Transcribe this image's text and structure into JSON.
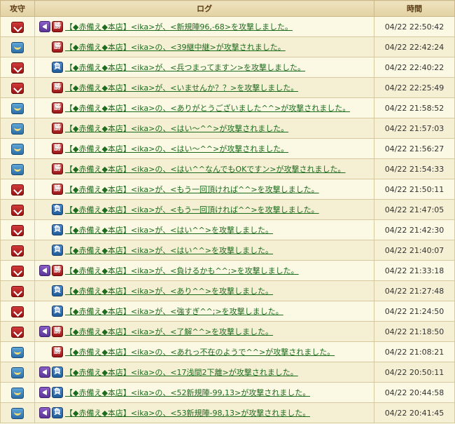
{
  "header": {
    "side": "攻守",
    "log": "ログ",
    "time": "時間"
  },
  "rows": [
    {
      "side": "attack",
      "icon": "purple",
      "result": "勝",
      "resultType": "win",
      "text": "【◆赤備え◆本店】<ika>が、<新規陣96,-68>を攻撃しました。",
      "time": "04/22 22:50:42"
    },
    {
      "side": "defense",
      "icon": "",
      "result": "勝",
      "resultType": "win",
      "text": "【◆赤備え◆本店】<ika>の、<39継中継>が攻撃されました。",
      "time": "04/22 22:42:24"
    },
    {
      "side": "attack",
      "icon": "",
      "result": "負",
      "resultType": "lose",
      "text": "【◆赤備え◆本店】<ika>が、<兵つまってますン>を攻撃しました。",
      "time": "04/22 22:40:22"
    },
    {
      "side": "attack",
      "icon": "",
      "result": "勝",
      "resultType": "win",
      "text": "【◆赤備え◆本店】<ika>が、<いませんか？？>を攻撃しました。",
      "time": "04/22 22:25:49"
    },
    {
      "side": "defense",
      "icon": "",
      "result": "勝",
      "resultType": "win",
      "text": "【◆赤備え◆本店】<ika>の、<ありがとうございました^^>が攻撃されました。",
      "time": "04/22 21:58:52"
    },
    {
      "side": "defense",
      "icon": "",
      "result": "勝",
      "resultType": "win",
      "text": "【◆赤備え◆本店】<ika>の、<はい～^^>が攻撃されました。",
      "time": "04/22 21:57:03"
    },
    {
      "side": "defense",
      "icon": "",
      "result": "勝",
      "resultType": "win",
      "text": "【◆赤備え◆本店】<ika>の、<はい～^^>が攻撃されました。",
      "time": "04/22 21:56:27"
    },
    {
      "side": "defense",
      "icon": "",
      "result": "勝",
      "resultType": "win",
      "text": "【◆赤備え◆本店】<ika>の、<はい^^なんでもOKですン>が攻撃されました。",
      "time": "04/22 21:54:33"
    },
    {
      "side": "attack",
      "icon": "",
      "result": "勝",
      "resultType": "win",
      "text": "【◆赤備え◆本店】<ika>が、<もう一回頂ければ^^>を攻撃しました。",
      "time": "04/22 21:50:11"
    },
    {
      "side": "attack",
      "icon": "",
      "result": "負",
      "resultType": "lose",
      "text": "【◆赤備え◆本店】<ika>が、<もう一回頂ければ^^>を攻撃しました。",
      "time": "04/22 21:47:05"
    },
    {
      "side": "attack",
      "icon": "",
      "result": "負",
      "resultType": "lose",
      "text": "【◆赤備え◆本店】<ika>が、<はい^^>を攻撃しました。",
      "time": "04/22 21:42:30"
    },
    {
      "side": "attack",
      "icon": "",
      "result": "負",
      "resultType": "lose",
      "text": "【◆赤備え◆本店】<ika>が、<はい^^>を攻撃しました。",
      "time": "04/22 21:40:07"
    },
    {
      "side": "attack",
      "icon": "purple",
      "result": "勝",
      "resultType": "win",
      "text": "【◆赤備え◆本店】<ika>が、<負けるかも^^;>を攻撃しました。",
      "time": "04/22 21:33:18"
    },
    {
      "side": "attack",
      "icon": "",
      "result": "負",
      "resultType": "lose",
      "text": "【◆赤備え◆本店】<ika>が、<あり^^>を攻撃しました。",
      "time": "04/22 21:27:48"
    },
    {
      "side": "attack",
      "icon": "",
      "result": "負",
      "resultType": "lose",
      "text": "【◆赤備え◆本店】<ika>が、<強すぎ^^;>を攻撃しました。",
      "time": "04/22 21:24:50"
    },
    {
      "side": "attack",
      "icon": "purple",
      "result": "勝",
      "resultType": "win",
      "text": "【◆赤備え◆本店】<ika>が、<了解^^>を攻撃しました。",
      "time": "04/22 21:18:50"
    },
    {
      "side": "defense",
      "icon": "",
      "result": "勝",
      "resultType": "win",
      "text": "【◆赤備え◆本店】<ika>の、<あれっ不在のようで^^>が攻撃されました。",
      "time": "04/22 21:08:21"
    },
    {
      "side": "defense",
      "icon": "purple",
      "result": "負",
      "resultType": "lose",
      "text": "【◆赤備え◆本店】<ika>の、<17浅間2下離>が攻撃されました。",
      "time": "04/22 20:50:11"
    },
    {
      "side": "defense",
      "icon": "purple",
      "result": "負",
      "resultType": "lose",
      "text": "【◆赤備え◆本店】<ika>の、<52新規陣-99,13>が攻撃されました。",
      "time": "04/22 20:44:58"
    },
    {
      "side": "defense",
      "icon": "purple",
      "result": "負",
      "resultType": "lose",
      "text": "【◆赤備え◆本店】<ika>の、<53新規陣-98,13>が攻撃されました。",
      "time": "04/22 20:41:45"
    }
  ]
}
